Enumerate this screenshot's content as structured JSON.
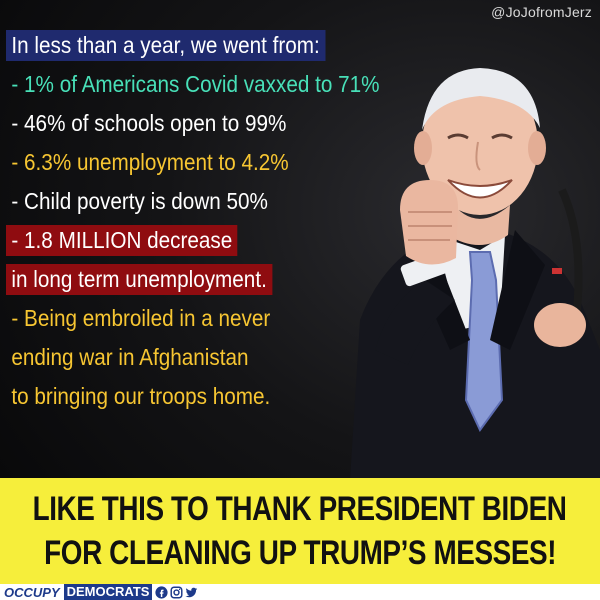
{
  "handle": "@JoJofromJerz",
  "headline": "In less than a year, we went from:",
  "items": [
    {
      "text": "- 1% of Americans Covid vaxxed to 71%"
    },
    {
      "text": "- 46% of schools open to 99%"
    },
    {
      "text": "- 6.3% unemployment to 4.2%"
    },
    {
      "text": "- Child poverty is down 50%"
    },
    {
      "text": "- 1.8 MILLION decrease"
    },
    {
      "text": "in long term unemployment."
    },
    {
      "text": "- Being embroiled in a never"
    },
    {
      "text": "ending war in Afghanistan"
    },
    {
      "text": "to bringing our troops home."
    }
  ],
  "colors": {
    "headline_bg": "#1f2a6e",
    "teal": "#48e0b8",
    "yellow": "#f7c632",
    "red_highlight": "#8f0c10",
    "banner": "#f6ee3b",
    "brand_blue": "#1d3a8a"
  },
  "banner": {
    "line1": "LIKE THIS TO THANK PRESIDENT BIDEN",
    "line2": "FOR CLEANING UP TRUMP’S MESSES!"
  },
  "footer": {
    "brand_occupy": "OCCUPY",
    "brand_democrats": "DEMOCRATS",
    "icons": [
      "facebook-icon",
      "instagram-icon",
      "twitter-icon"
    ]
  }
}
